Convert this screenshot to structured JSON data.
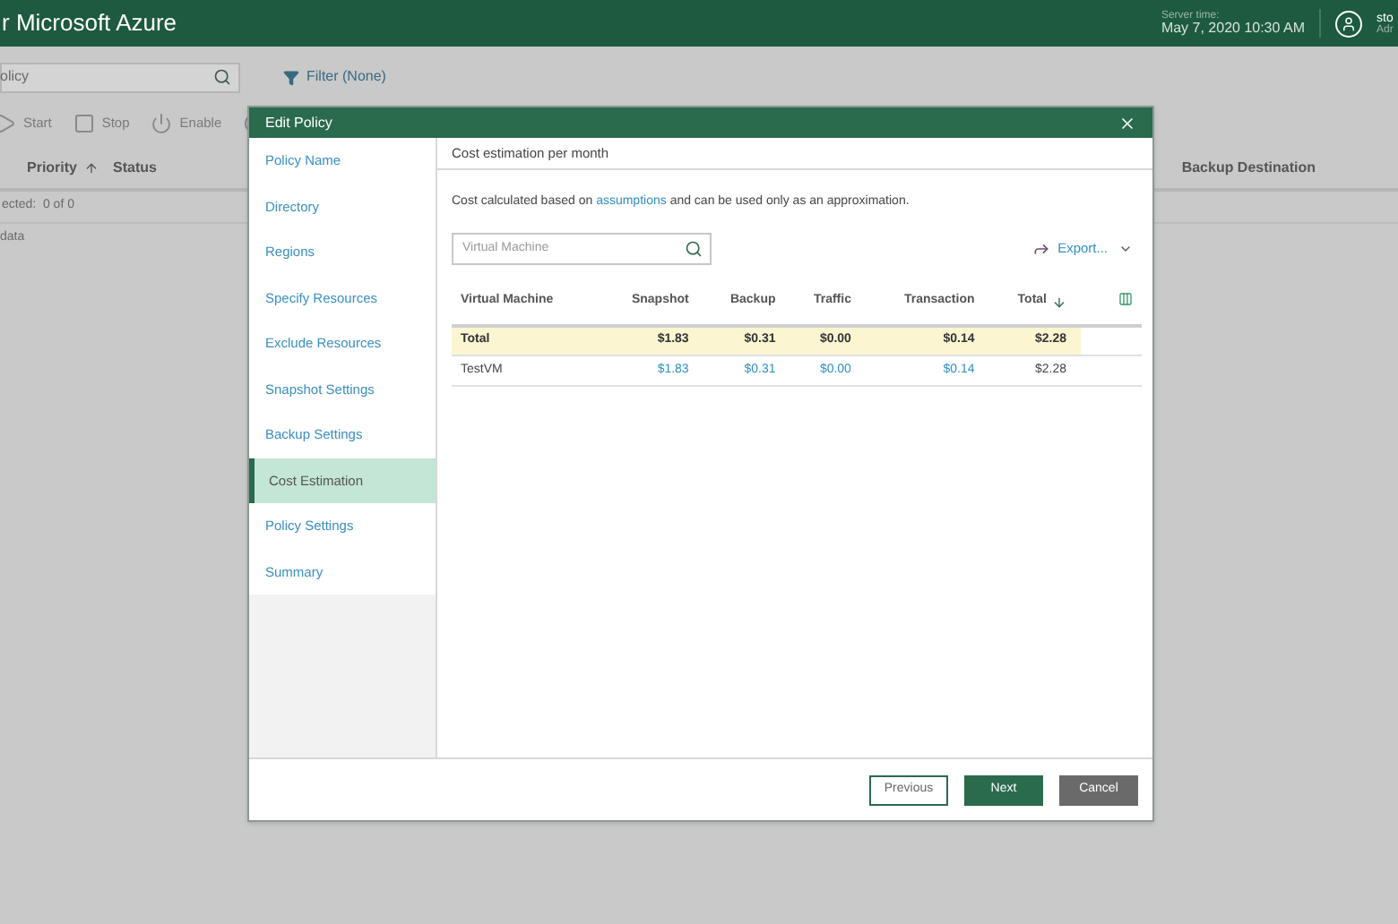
{
  "app": {
    "title": "r Microsoft Azure",
    "server_time_label": "Server time:",
    "server_time": "May 7, 2020 10:30 AM",
    "user_name": "sto",
    "user_role": "Adr"
  },
  "search": {
    "value": "olicy"
  },
  "filter": {
    "label": "Filter (None)"
  },
  "toolbar": [
    {
      "kind": "start",
      "label": "Start"
    },
    {
      "kind": "stop",
      "label": "Stop"
    },
    {
      "kind": "enable",
      "label": "Enable"
    },
    {
      "kind": "disable"
    }
  ],
  "columns": [
    {
      "label": "Priority",
      "sort_ascending": true
    },
    {
      "label": "Status"
    },
    {
      "label": "Backup Destination"
    }
  ],
  "selected_text": "ected:  0 of 0",
  "empty_text": "data",
  "dialog": {
    "title": "Edit Policy",
    "steps": [
      {
        "label": "Policy Name",
        "selected": false
      },
      {
        "label": "Directory",
        "selected": false
      },
      {
        "label": "Regions",
        "selected": false
      },
      {
        "label": "Specify Resources",
        "selected": false
      },
      {
        "label": "Exclude Resources",
        "selected": false
      },
      {
        "label": "Snapshot Settings",
        "selected": false
      },
      {
        "label": "Backup Settings",
        "selected": false
      },
      {
        "label": "Cost Estimation",
        "selected": true
      },
      {
        "label": "Policy Settings",
        "selected": false
      },
      {
        "label": "Summary",
        "selected": false
      }
    ],
    "section_title": "Cost estimation per month",
    "note_before": "Cost calculated based on",
    "note_link": "assumptions",
    "note_after": "and can be used only as an approximation.",
    "vm_search": {
      "placeholder": "Virtual Machine"
    },
    "export": "Export...",
    "table": {
      "columns": [
        "Virtual Machine",
        "Snapshot",
        "Backup",
        "Traffic",
        "Transaction",
        "Total"
      ],
      "rows": [
        {
          "kind": "total",
          "cells": [
            "Total",
            "$1.83",
            "$0.31",
            "$0.00",
            "$0.14",
            "$2.28"
          ]
        },
        {
          "kind": "vm",
          "cells": [
            "TestVM",
            "$1.83",
            "$0.31",
            "$0.00",
            "$0.14",
            "$2.28"
          ]
        }
      ]
    },
    "buttons": [
      {
        "kind": "secondary",
        "label": "Previous"
      },
      {
        "kind": "primary",
        "label": "Next"
      },
      {
        "kind": "cancel",
        "label": "Cancel"
      }
    ]
  }
}
